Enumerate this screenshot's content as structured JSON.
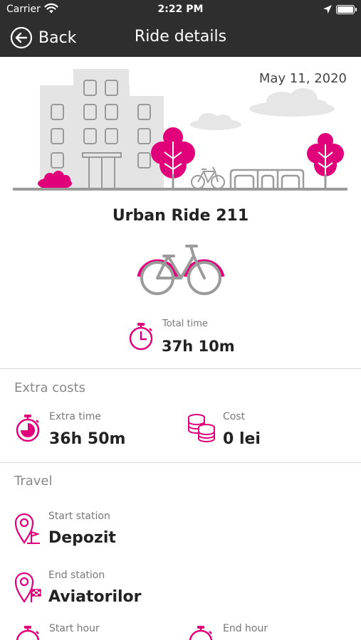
{
  "status_bar": {
    "carrier": "Carrier",
    "time": "2:22 PM"
  },
  "nav": {
    "back_label": "Back",
    "title": "Ride details"
  },
  "ride": {
    "date": "May 11, 2020",
    "name": "Urban Ride 211",
    "total_time_label": "Total time",
    "total_time_value": "37h 10m"
  },
  "extra_costs": {
    "title": "Extra costs",
    "extra_time_label": "Extra time",
    "extra_time_value": "36h 50m",
    "cost_label": "Cost",
    "cost_value": "0 lei"
  },
  "travel": {
    "title": "Travel",
    "start_station_label": "Start station",
    "start_station_value": "Depozit",
    "end_station_label": "End station",
    "end_station_value": "Aviatorilor",
    "start_hour_label": "Start hour",
    "end_hour_label": "End hour"
  },
  "colors": {
    "accent": "#e0007a",
    "header": "#2e2e2e",
    "illustration_gray": "#e4e4e4"
  },
  "icons": [
    "back-icon",
    "wifi-icon",
    "location-arrow-icon",
    "battery-icon",
    "bicycle-icon",
    "stopwatch-icon",
    "coins-icon",
    "map-pin-flag-icon",
    "map-pin-checkered-flag-icon"
  ]
}
